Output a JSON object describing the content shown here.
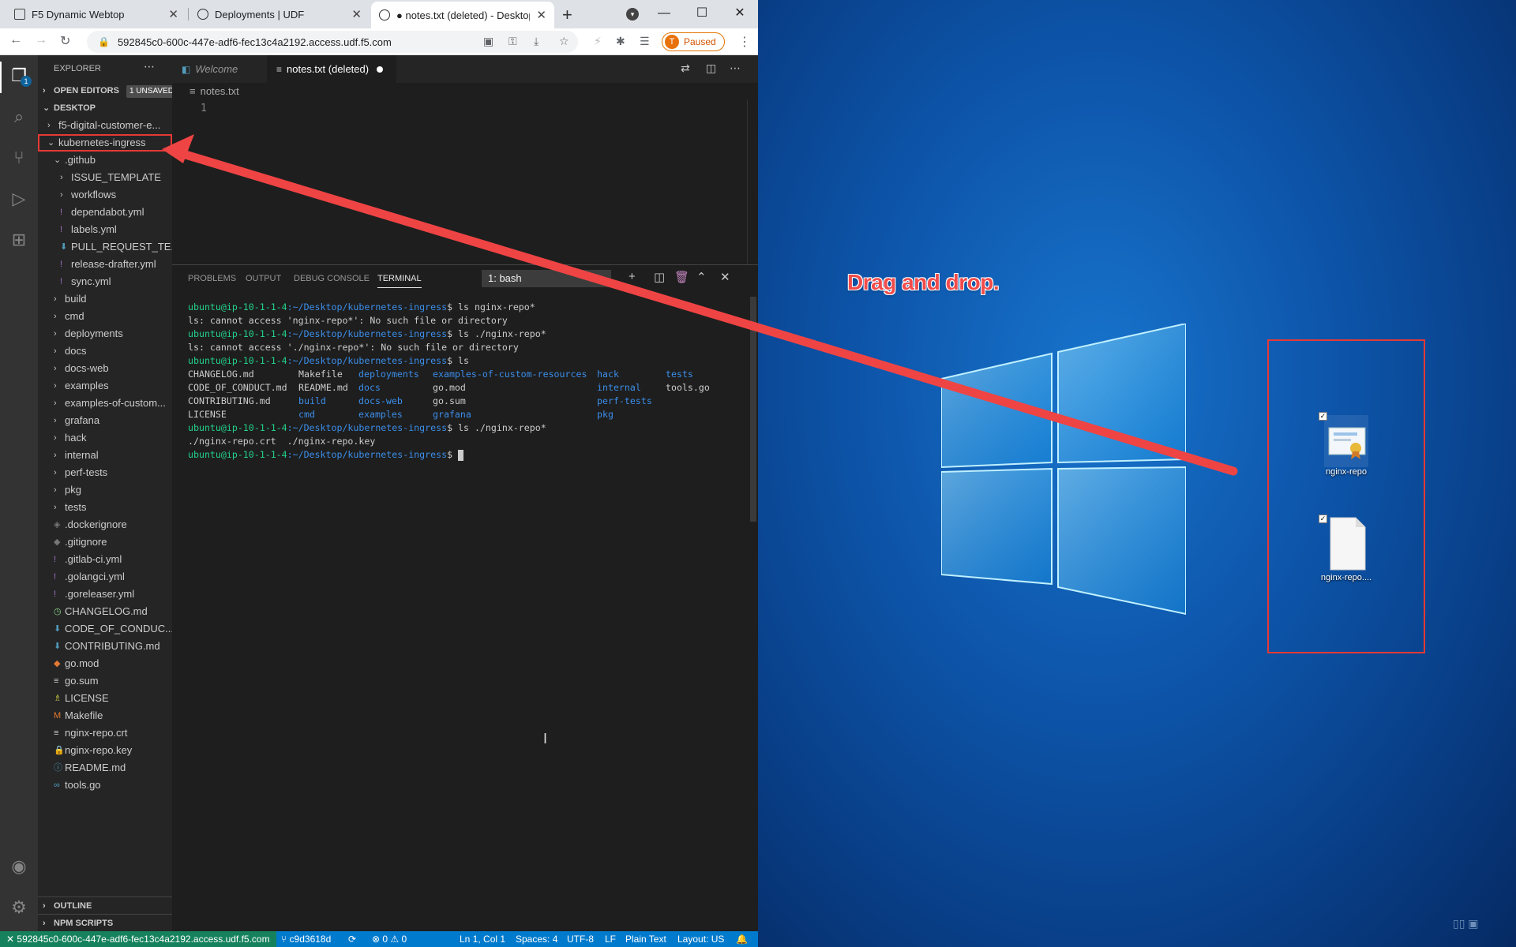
{
  "browser": {
    "tabs": [
      {
        "title": "F5 Dynamic Webtop"
      },
      {
        "title": "Deployments | UDF"
      },
      {
        "title": "● notes.txt (deleted) - Desktop"
      }
    ],
    "url": "592845c0-600c-447e-adf6-fec13c4a2192.access.udf.f5.com",
    "profile_initial": "T",
    "profile_status": "Paused"
  },
  "sidebar": {
    "title": "EXPLORER",
    "open_editors": "OPEN EDITORS",
    "unsaved_badge": "1 UNSAVED",
    "desktop_section": "DESKTOP",
    "outline": "OUTLINE",
    "npm_scripts": "NPM SCRIPTS",
    "activity_badge": "1"
  },
  "tree": [
    {
      "label": "f5-digital-customer-e...",
      "depth": 1,
      "kind": "folder",
      "open": false
    },
    {
      "label": "kubernetes-ingress",
      "depth": 1,
      "kind": "folder",
      "open": true,
      "highlight": true
    },
    {
      "label": ".github",
      "depth": 2,
      "kind": "folder",
      "open": true
    },
    {
      "label": "ISSUE_TEMPLATE",
      "depth": 3,
      "kind": "folder",
      "open": false
    },
    {
      "label": "workflows",
      "depth": 3,
      "kind": "folder",
      "open": false
    },
    {
      "label": "dependabot.yml",
      "depth": 3,
      "kind": "yml"
    },
    {
      "label": "labels.yml",
      "depth": 3,
      "kind": "yml"
    },
    {
      "label": "PULL_REQUEST_TE...",
      "depth": 3,
      "kind": "md"
    },
    {
      "label": "release-drafter.yml",
      "depth": 3,
      "kind": "yml"
    },
    {
      "label": "sync.yml",
      "depth": 3,
      "kind": "yml"
    },
    {
      "label": "build",
      "depth": 2,
      "kind": "folder",
      "open": false
    },
    {
      "label": "cmd",
      "depth": 2,
      "kind": "folder",
      "open": false
    },
    {
      "label": "deployments",
      "depth": 2,
      "kind": "folder",
      "open": false
    },
    {
      "label": "docs",
      "depth": 2,
      "kind": "folder",
      "open": false
    },
    {
      "label": "docs-web",
      "depth": 2,
      "kind": "folder",
      "open": false
    },
    {
      "label": "examples",
      "depth": 2,
      "kind": "folder",
      "open": false
    },
    {
      "label": "examples-of-custom...",
      "depth": 2,
      "kind": "folder",
      "open": false
    },
    {
      "label": "grafana",
      "depth": 2,
      "kind": "folder",
      "open": false
    },
    {
      "label": "hack",
      "depth": 2,
      "kind": "folder",
      "open": false
    },
    {
      "label": "internal",
      "depth": 2,
      "kind": "folder",
      "open": false
    },
    {
      "label": "perf-tests",
      "depth": 2,
      "kind": "folder",
      "open": false
    },
    {
      "label": "pkg",
      "depth": 2,
      "kind": "folder",
      "open": false
    },
    {
      "label": "tests",
      "depth": 2,
      "kind": "folder",
      "open": false
    },
    {
      "label": ".dockerignore",
      "depth": 2,
      "kind": "docker"
    },
    {
      "label": ".gitignore",
      "depth": 2,
      "kind": "git"
    },
    {
      "label": ".gitlab-ci.yml",
      "depth": 2,
      "kind": "yml"
    },
    {
      "label": ".golangci.yml",
      "depth": 2,
      "kind": "yml"
    },
    {
      "label": ".goreleaser.yml",
      "depth": 2,
      "kind": "yml"
    },
    {
      "label": "CHANGELOG.md",
      "depth": 2,
      "kind": "changelog"
    },
    {
      "label": "CODE_OF_CONDUC...",
      "depth": 2,
      "kind": "md"
    },
    {
      "label": "CONTRIBUTING.md",
      "depth": 2,
      "kind": "md"
    },
    {
      "label": "go.mod",
      "depth": 2,
      "kind": "gomod"
    },
    {
      "label": "go.sum",
      "depth": 2,
      "kind": "text"
    },
    {
      "label": "LICENSE",
      "depth": 2,
      "kind": "license"
    },
    {
      "label": "Makefile",
      "depth": 2,
      "kind": "make"
    },
    {
      "label": "nginx-repo.crt",
      "depth": 2,
      "kind": "text"
    },
    {
      "label": "nginx-repo.key",
      "depth": 2,
      "kind": "key"
    },
    {
      "label": "README.md",
      "depth": 2,
      "kind": "info"
    },
    {
      "label": "tools.go",
      "depth": 2,
      "kind": "go"
    }
  ],
  "editor": {
    "tabs": [
      {
        "label": "Welcome"
      },
      {
        "label": "notes.txt (deleted)"
      }
    ],
    "breadcrumb": "notes.txt",
    "line_number": "1"
  },
  "panel": {
    "tabs": [
      "PROBLEMS",
      "OUTPUT",
      "DEBUG CONSOLE",
      "TERMINAL"
    ],
    "shell": "1: bash"
  },
  "terminal": {
    "prompt": "ubuntu@ip-10-1-1-4",
    "path": ":~/Desktop/kubernetes-ingress",
    "lines": [
      {
        "type": "cmd",
        "text": "$ ls nginx-repo*"
      },
      {
        "type": "out",
        "text": "ls: cannot access 'nginx-repo*': No such file or directory"
      },
      {
        "type": "cmd",
        "text": "$ ls ./nginx-repo*"
      },
      {
        "type": "out",
        "text": "ls: cannot access './nginx-repo*': No such file or directory"
      },
      {
        "type": "cmd",
        "text": "$ ls"
      },
      {
        "type": "ls",
        "cells": [
          {
            "t": "CHANGELOG.md",
            "c": "f",
            "col": 0
          },
          {
            "t": "Makefile",
            "c": "f",
            "col": 1
          },
          {
            "t": "deployments",
            "c": "d",
            "col": 2
          },
          {
            "t": "examples-of-custom-resources",
            "c": "d",
            "col": 3
          },
          {
            "t": "hack",
            "c": "d",
            "col": 4
          },
          {
            "t": "tests",
            "c": "d",
            "col": 5
          }
        ]
      },
      {
        "type": "ls",
        "cells": [
          {
            "t": "CODE_OF_CONDUCT.md",
            "c": "f",
            "col": 0
          },
          {
            "t": "README.md",
            "c": "f",
            "col": 1
          },
          {
            "t": "docs",
            "c": "d",
            "col": 2
          },
          {
            "t": "go.mod",
            "c": "f",
            "col": 3
          },
          {
            "t": "internal",
            "c": "d",
            "col": 4
          },
          {
            "t": "tools.go",
            "c": "f",
            "col": 5
          }
        ]
      },
      {
        "type": "ls",
        "cells": [
          {
            "t": "CONTRIBUTING.md",
            "c": "f",
            "col": 0
          },
          {
            "t": "build",
            "c": "d",
            "col": 1
          },
          {
            "t": "docs-web",
            "c": "d",
            "col": 2
          },
          {
            "t": "go.sum",
            "c": "f",
            "col": 3
          },
          {
            "t": "perf-tests",
            "c": "d",
            "col": 4
          }
        ]
      },
      {
        "type": "ls",
        "cells": [
          {
            "t": "LICENSE",
            "c": "f",
            "col": 0
          },
          {
            "t": "cmd",
            "c": "d",
            "col": 1
          },
          {
            "t": "examples",
            "c": "d",
            "col": 2
          },
          {
            "t": "grafana",
            "c": "d",
            "col": 3
          },
          {
            "t": "pkg",
            "c": "d",
            "col": 4
          }
        ]
      },
      {
        "type": "cmd",
        "text": "$ ls ./nginx-repo*"
      },
      {
        "type": "out",
        "text": "./nginx-repo.crt  ./nginx-repo.key"
      },
      {
        "type": "cmd",
        "text": "$ ",
        "cursor": true
      }
    ]
  },
  "statusbar": {
    "remote": "592845c0-600c-447e-adf6-fec13c4a2192.access.udf.f5.com",
    "branch": "c9d3618d",
    "problems": "⊗ 0 ⚠ 0",
    "position": "Ln 1, Col 1",
    "spaces": "Spaces: 4",
    "encoding": "UTF-8",
    "eol": "LF",
    "language": "Plain Text",
    "layout": "Layout: US"
  },
  "desktop": {
    "annotation": "Drag and drop.",
    "icons": [
      {
        "label": "nginx-repo"
      },
      {
        "label": "nginx-repo...."
      }
    ]
  },
  "colors": {
    "annotation_red": "#e53935",
    "vscode_blue": "#007acc",
    "prompt_green": "#23d18b",
    "dir_blue": "#3b8eea"
  }
}
